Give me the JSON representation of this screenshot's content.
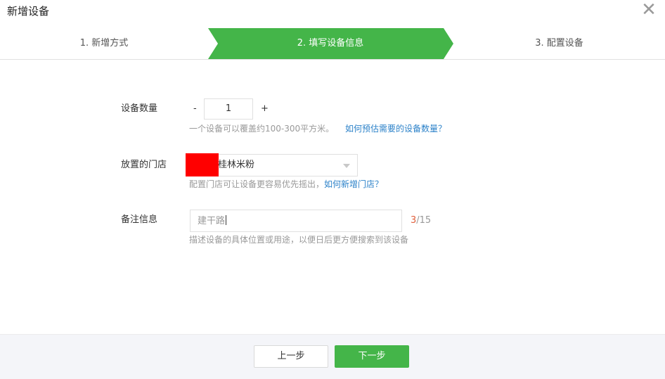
{
  "dialog": {
    "title": "新增设备"
  },
  "steps": [
    {
      "label": "1. 新增方式",
      "active": false
    },
    {
      "label": "2. 填写设备信息",
      "active": true
    },
    {
      "label": "3. 配置设备",
      "active": false
    }
  ],
  "colors": {
    "accent": "#44b549",
    "link": "#2c82c9",
    "counter_current": "#e15f3b",
    "redaction": "#ff0000"
  },
  "form": {
    "quantity": {
      "label": "设备数量",
      "minus": "-",
      "value": "1",
      "plus": "+",
      "hint": "一个设备可以覆盖约100-300平方米。",
      "link": "如何预估需要的设备数量？"
    },
    "store": {
      "label": "放置的门店",
      "selected": "桂林米粉",
      "hint": "配置门店可让设备更容易优先摇出，",
      "link": "如何新增门店？"
    },
    "note": {
      "label": "备注信息",
      "value": "建干路",
      "counter_current": "3",
      "counter_max": "/15",
      "hint": "描述设备的具体位置或用途，以便日后更方便搜索到该设备"
    }
  },
  "footer": {
    "prev_label": "上一步",
    "next_label": "下一步"
  }
}
